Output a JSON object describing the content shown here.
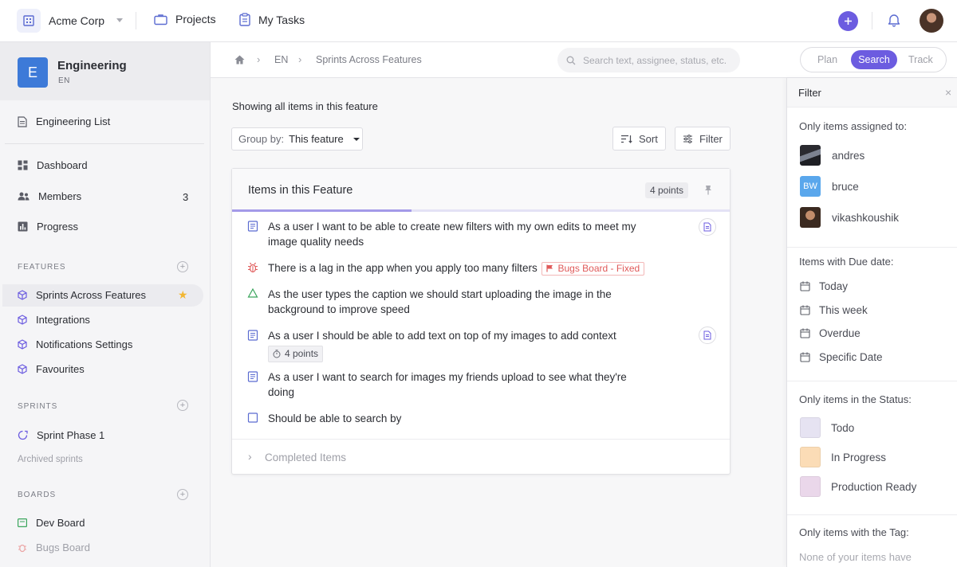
{
  "topbar": {
    "org_name": "Acme Corp",
    "nav": [
      {
        "label": "Projects",
        "icon": "briefcase-icon"
      },
      {
        "label": "My Tasks",
        "icon": "clipboard-icon"
      }
    ],
    "accent": "#6c5ce0"
  },
  "sidebar": {
    "project": {
      "badge": "E",
      "name": "Engineering",
      "code": "EN",
      "color": "#3d7ad8"
    },
    "list_link": "Engineering List",
    "nav": [
      {
        "label": "Dashboard",
        "icon": "dashboard-icon"
      },
      {
        "label": "Members",
        "icon": "members-icon",
        "count": "3"
      },
      {
        "label": "Progress",
        "icon": "progress-icon"
      }
    ],
    "features": {
      "title": "FEATURES",
      "items": [
        "Sprints Across Features",
        "Integrations",
        "Notifications Settings",
        "Favourites"
      ]
    },
    "sprints": {
      "title": "SPRINTS",
      "items": [
        "Sprint Phase 1"
      ],
      "archived": "Archived sprints"
    },
    "boards": {
      "title": "BOARDS",
      "items": [
        "Dev Board",
        "Bugs Board"
      ]
    }
  },
  "breadcrumb": {
    "items": [
      "EN",
      "Sprints Across Features"
    ]
  },
  "search": {
    "placeholder": "Search text, assignee, status, etc."
  },
  "mode": {
    "options": [
      "Plan",
      "Search",
      "Track"
    ],
    "active": "Search"
  },
  "main": {
    "showing": "Showing all items in this feature",
    "group_by_label": "Group by:",
    "group_by_value": "This feature",
    "sort_label": "Sort",
    "filter_label": "Filter",
    "card": {
      "title": "Items in this Feature",
      "points": "4 points",
      "progress": 0.36,
      "tasks": [
        {
          "type": "story",
          "text": "As a user I want to be able to create new filters with my own edits to meet my image quality needs"
        },
        {
          "type": "bug",
          "text": "There is a lag in the app when you apply too many filters",
          "tag": "Bugs Board - Fixed"
        },
        {
          "type": "task",
          "text": "As the user types the caption we should start uploading the image in the background to improve speed"
        },
        {
          "type": "story",
          "text": "As a user I should be able to add text on top of my images to add context",
          "points": "4 points"
        },
        {
          "type": "story",
          "text": "As a user I want to search for images my friends upload to see what they're doing"
        },
        {
          "type": "checkbox",
          "text": "Should be able to search by"
        }
      ],
      "completed_label": "Completed Items"
    }
  },
  "filter_panel": {
    "title": "Filter",
    "assigned_heading": "Only items assigned to:",
    "users": [
      {
        "name": "andres",
        "avatar": "photo"
      },
      {
        "name": "bruce",
        "avatar": "BW"
      },
      {
        "name": "vikashkoushik",
        "avatar": "photo"
      }
    ],
    "due_heading": "Items with Due date:",
    "due_options": [
      "Today",
      "This week",
      "Overdue",
      "Specific Date"
    ],
    "status_heading": "Only items in the Status:",
    "statuses": [
      {
        "name": "Todo",
        "color": "#e6e3f2"
      },
      {
        "name": "In Progress",
        "color": "#fbdcb6"
      },
      {
        "name": "Production Ready",
        "color": "#ead7ea"
      }
    ],
    "tag_heading": "Only items with the Tag:",
    "tag_note": "None of your items have"
  }
}
